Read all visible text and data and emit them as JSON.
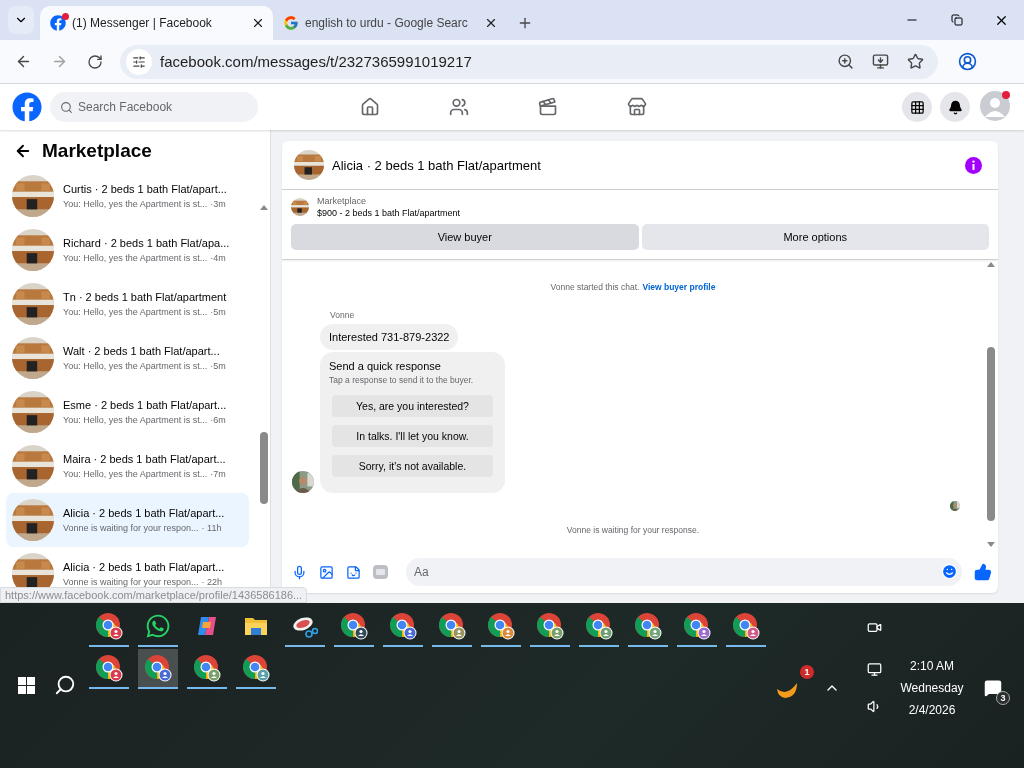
{
  "browser": {
    "tabs": [
      {
        "kind": "facebook",
        "title": "(1) Messenger | Facebook",
        "selected": true,
        "notification": true
      },
      {
        "kind": "google",
        "title": "english to urdu - Google Searc",
        "selected": false,
        "notification": false
      }
    ],
    "address": "facebook.com/messages/t/2327365991019217"
  },
  "facebook_bar": {
    "search_placeholder": "Search Facebook",
    "account_alert": true
  },
  "sidebar": {
    "title": "Marketplace",
    "conversations": [
      {
        "title": "Curtis · 2 beds 1 bath Flat/apart...",
        "preview": "You: Hello, yes the Apartment is st...",
        "time": "·3m",
        "selected": false
      },
      {
        "title": "Richard · 2 beds 1 bath Flat/apa...",
        "preview": "You: Hello, yes the Apartment is st...",
        "time": "·4m",
        "selected": false
      },
      {
        "title": "Tn · 2 beds 1 bath Flat/apartment",
        "preview": "You: Hello, yes the Apartment is st...",
        "time": "·5m",
        "selected": false
      },
      {
        "title": "Walt · 2 beds 1 bath Flat/apart...",
        "preview": "You: Hello, yes the Apartment is st...",
        "time": "·5m",
        "selected": false
      },
      {
        "title": "Esme · 2 beds 1 bath Flat/apart...",
        "preview": "You: Hello, yes the Apartment is st...",
        "time": "·6m",
        "selected": false
      },
      {
        "title": "Maira · 2 beds 1 bath Flat/apart...",
        "preview": "You: Hello, yes the Apartment is st...",
        "time": "·7m",
        "selected": false
      },
      {
        "title": "Alicia · 2 beds 1 bath Flat/apart...",
        "preview": "Vonne is waiting for your respon...",
        "time": "· 11h",
        "selected": true
      },
      {
        "title": "Alicia · 2 beds 1 bath Flat/apart...",
        "preview": "Vonne is waiting for your respon...",
        "time": "· 22h",
        "selected": false
      }
    ]
  },
  "status_url": "https://www.facebook.com/marketplace/profile/1436586186...",
  "chat": {
    "title": "Alicia · 2 beds 1 bath Flat/apartment",
    "listing": {
      "label": "Marketplace",
      "title": "$900 - 2 beds 1 bath Flat/apartment"
    },
    "buttons": [
      {
        "label": "View buyer",
        "highlighted": true
      },
      {
        "label": "More options",
        "highlighted": false
      }
    ],
    "intro": {
      "text": "Vonne started this chat.",
      "link": "View buyer profile"
    },
    "sender": "Vonne",
    "message": "Interested 731-879-2322",
    "quick_response": {
      "title": "Send a quick response",
      "subtitle": "Tap a response to send it to the buyer.",
      "options": [
        "Yes, are you interested?",
        "In talks. I'll let you know.",
        "Sorry, it's not available."
      ]
    },
    "status": "Vonne is waiting for your response.",
    "composer_placeholder": "Aa"
  },
  "taskbar": {
    "rows": [
      [
        {
          "kind": "chrome",
          "color": "#d83a4e",
          "running": true,
          "selected": false
        },
        {
          "kind": "whatsapp",
          "running": true,
          "selected": false
        },
        {
          "kind": "copilot",
          "running": false,
          "selected": false
        },
        {
          "kind": "folder",
          "running": false,
          "selected": false
        },
        {
          "kind": "snip",
          "running": true,
          "selected": false
        },
        {
          "kind": "chrome",
          "color": "#2f4a5a",
          "running": true,
          "selected": false
        },
        {
          "kind": "chrome",
          "color": "#4a6bd6",
          "running": true,
          "selected": false
        },
        {
          "kind": "chrome",
          "color": "#9a9460",
          "running": true,
          "selected": false
        },
        {
          "kind": "chrome",
          "color": "#d98a3a",
          "running": true,
          "selected": false
        },
        {
          "kind": "chrome",
          "color": "#7aa06a",
          "running": true,
          "selected": false
        },
        {
          "kind": "chrome",
          "color": "#6f9f70",
          "running": true,
          "selected": false
        },
        {
          "kind": "chrome",
          "color": "#72a57a",
          "running": true,
          "selected": false
        },
        {
          "kind": "chrome",
          "color": "#9a6ad0",
          "running": true,
          "selected": false
        },
        {
          "kind": "chrome",
          "color": "#d05a8a",
          "running": true,
          "selected": false
        }
      ],
      [
        {
          "kind": "chrome",
          "color": "#d83a4e",
          "running": true,
          "selected": false
        },
        {
          "kind": "chrome",
          "color": "#4a6bd6",
          "running": true,
          "selected": true
        },
        {
          "kind": "chrome",
          "color": "#7aa06a",
          "running": true,
          "selected": false
        },
        {
          "kind": "chrome",
          "color": "#5aa0a8",
          "running": true,
          "selected": false
        }
      ]
    ],
    "tray_badge": "1",
    "time": "2:10 AM",
    "day": "Wednesday",
    "date": "2/4/2026",
    "notifications": "3"
  }
}
